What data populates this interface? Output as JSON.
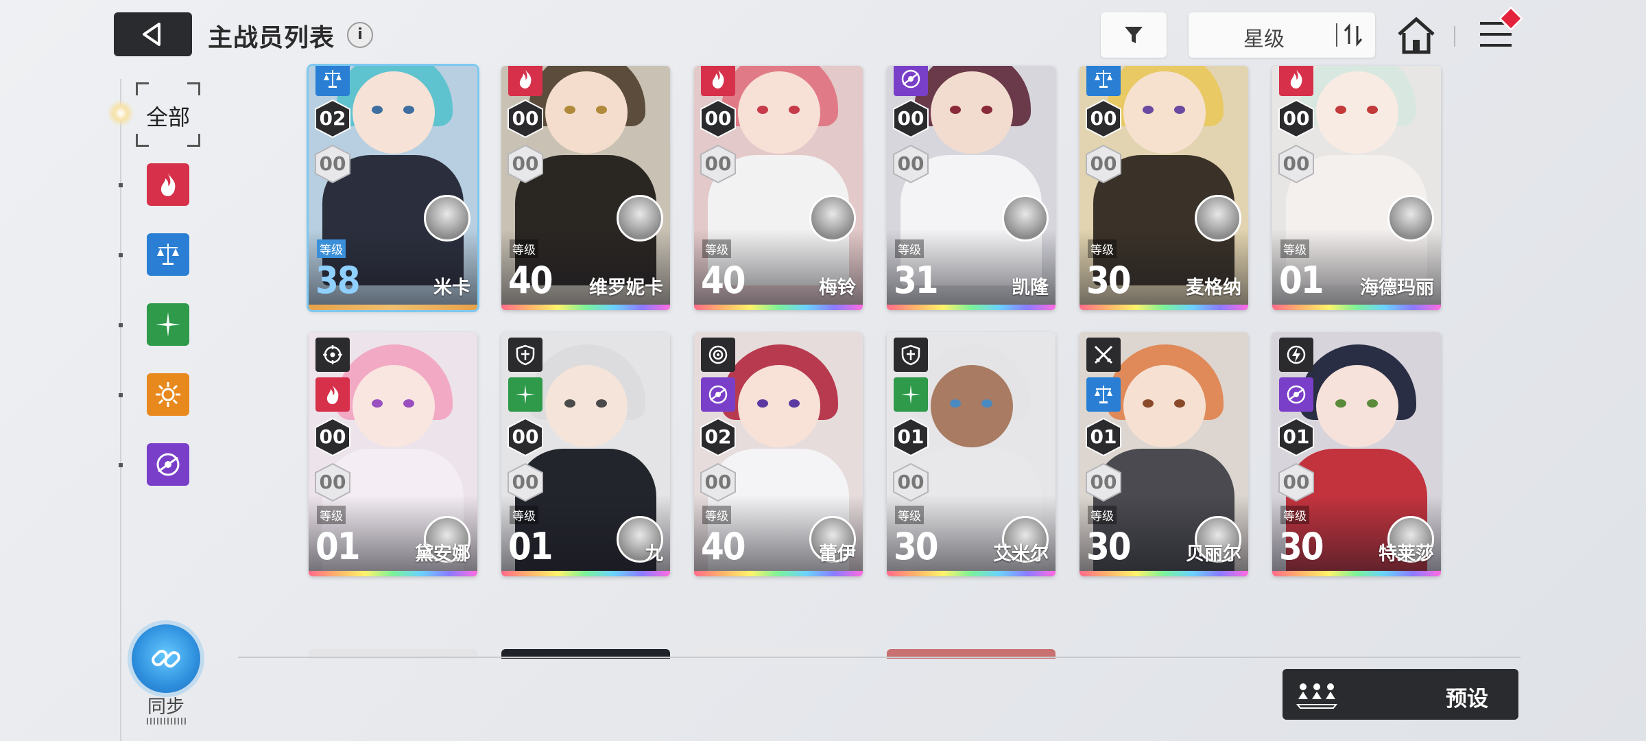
{
  "header": {
    "title": "主战员列表",
    "info_glyph": "i",
    "sort_label": "星级"
  },
  "sidebar": {
    "all_label": "全部",
    "filters": [
      {
        "name": "burn",
        "color": "#d6304a"
      },
      {
        "name": "balance",
        "color": "#2a7fd4"
      },
      {
        "name": "electric",
        "color": "#2e9a4a"
      },
      {
        "name": "solar",
        "color": "#e8891e"
      },
      {
        "name": "vortex",
        "color": "#7a3fc8"
      }
    ],
    "sync_label": "同步"
  },
  "cards_row1": [
    {
      "name": "米卡",
      "level": "38",
      "level_label": "等级",
      "star": "02",
      "sub": "00",
      "class_color": "#2a7fd4",
      "bg": "#b7cfe0",
      "hair": "#5fc2cf",
      "skin": "#f6e2d6",
      "eye": "#3f6fa0",
      "body": "#2b2f3d",
      "selected": true
    },
    {
      "name": "维罗妮卡",
      "level": "40",
      "level_label": "等级",
      "star": "00",
      "sub": "00",
      "class_color": "#d6304a",
      "bg": "#c9c2b4",
      "hair": "#5b4c3c",
      "skin": "#f4ddcc",
      "eye": "#b08a3a",
      "body": "#2a2622",
      "selected": false
    },
    {
      "name": "梅铃",
      "level": "40",
      "level_label": "等级",
      "star": "00",
      "sub": "00",
      "class_color": "#d6304a",
      "bg": "#e3c9c9",
      "hair": "#e07a86",
      "skin": "#f7e0d6",
      "eye": "#c73a4a",
      "body": "#f2f2f2",
      "selected": false
    },
    {
      "name": "凯隆",
      "level": "31",
      "level_label": "等级",
      "star": "00",
      "sub": "00",
      "class_color": "#7a3fc8",
      "bg": "#d6d6dc",
      "hair": "#6a3a4a",
      "skin": "#f2dccf",
      "eye": "#8a2a3a",
      "body": "#f4f4f6",
      "selected": false
    },
    {
      "name": "麦格纳",
      "level": "30",
      "level_label": "等级",
      "star": "00",
      "sub": "00",
      "class_color": "#2a7fd4",
      "bg": "#e2d4b0",
      "hair": "#e8c964",
      "skin": "#f6e1cf",
      "eye": "#6a4aa0",
      "body": "#3a3228",
      "selected": false
    },
    {
      "name": "海德玛丽",
      "level": "01",
      "level_label": "等级",
      "star": "00",
      "sub": "00",
      "class_color": "#d6304a",
      "bg": "#e8e6e4",
      "hair": "#d8e8e0",
      "skin": "#f8ebe4",
      "eye": "#c23a3a",
      "body": "#f4f0ee",
      "selected": false
    }
  ],
  "cards_row2": [
    {
      "name": "黛安娜",
      "level": "01",
      "level_label": "等级",
      "star": "00",
      "sub": "00",
      "class_color": "#d6304a",
      "role_icon": "target",
      "bg": "#ece4ea",
      "hair": "#f2a9c4",
      "skin": "#fae6e0",
      "eye": "#9a4fc0",
      "body": "#f4eef4",
      "selected": false
    },
    {
      "name": "九",
      "level": "01",
      "level_label": "等级",
      "star": "00",
      "sub": "00",
      "class_color": "#2e9a4a",
      "role_icon": "shield",
      "bg": "#e4e4e6",
      "hair": "#dcdcde",
      "skin": "#f4e4da",
      "eye": "#4a4a4a",
      "body": "#23252c",
      "selected": false
    },
    {
      "name": "蕾伊",
      "level": "40",
      "level_label": "等级",
      "star": "02",
      "sub": "00",
      "class_color": "#7a3fc8",
      "role_icon": "aim",
      "bg": "#e6dcdc",
      "hair": "#b83a4e",
      "skin": "#f8e2d8",
      "eye": "#5a3aa0",
      "body": "#f4f4f6",
      "selected": false
    },
    {
      "name": "艾米尔",
      "level": "30",
      "level_label": "等级",
      "star": "01",
      "sub": "00",
      "class_color": "#2e9a4a",
      "role_icon": "shield",
      "bg": "#e6e6e8",
      "hair": "#e4e4e6",
      "skin": "#a97b62",
      "eye": "#4a8ac0",
      "body": "#e8e8ea",
      "selected": false
    },
    {
      "name": "贝丽尔",
      "level": "30",
      "level_label": "等级",
      "star": "01",
      "sub": "00",
      "class_color": "#2a7fd4",
      "role_icon": "swords",
      "bg": "#ddd6d0",
      "hair": "#e08a5a",
      "skin": "#f6e0d2",
      "eye": "#8a4a2a",
      "body": "#4a4a50",
      "selected": false
    },
    {
      "name": "特莱莎",
      "level": "30",
      "level_label": "等级",
      "star": "01",
      "sub": "00",
      "class_color": "#7a3fc8",
      "role_icon": "bolt",
      "bg": "#d8d4dc",
      "hair": "#2a2e44",
      "skin": "#f6e2da",
      "eye": "#5a8a3a",
      "body": "#c3333e",
      "selected": false
    }
  ],
  "preset": {
    "label": "预设"
  }
}
